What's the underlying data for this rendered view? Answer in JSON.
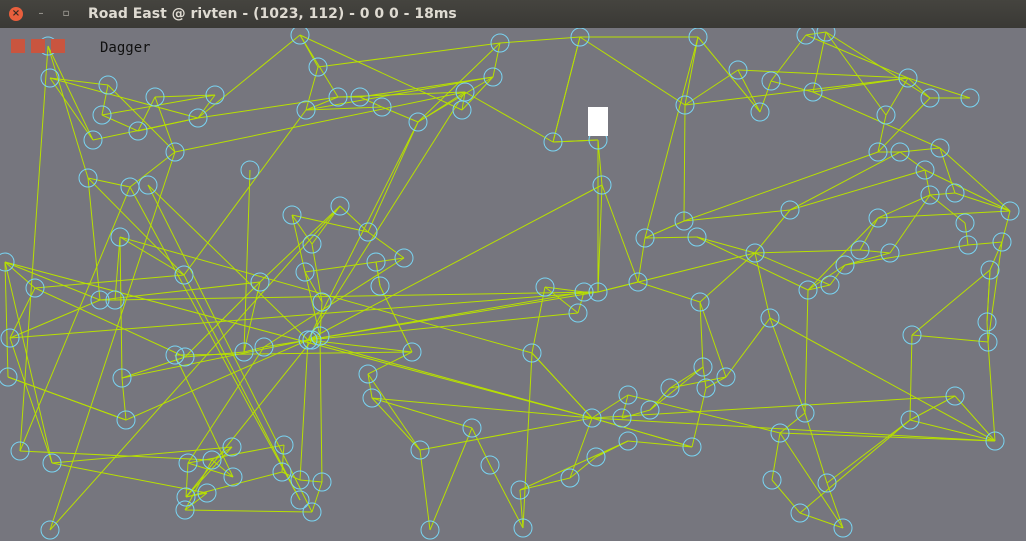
{
  "window": {
    "title": "Road East @ rivten - (1023, 112) - 0 0 0 - 18ms",
    "close_glyph": "×",
    "minimize_glyph": "–",
    "maximize_glyph": "▫"
  },
  "hud": {
    "lives": 3,
    "weapon": "Dagger"
  },
  "colors": {
    "background": "#76767e",
    "node_stroke": "#79d4f2",
    "edge_stroke": "#b8e000",
    "life_block": "#c9553f",
    "player": "#ffffff"
  },
  "icons": [
    "close-icon",
    "minimize-icon",
    "maximize-icon"
  ]
}
